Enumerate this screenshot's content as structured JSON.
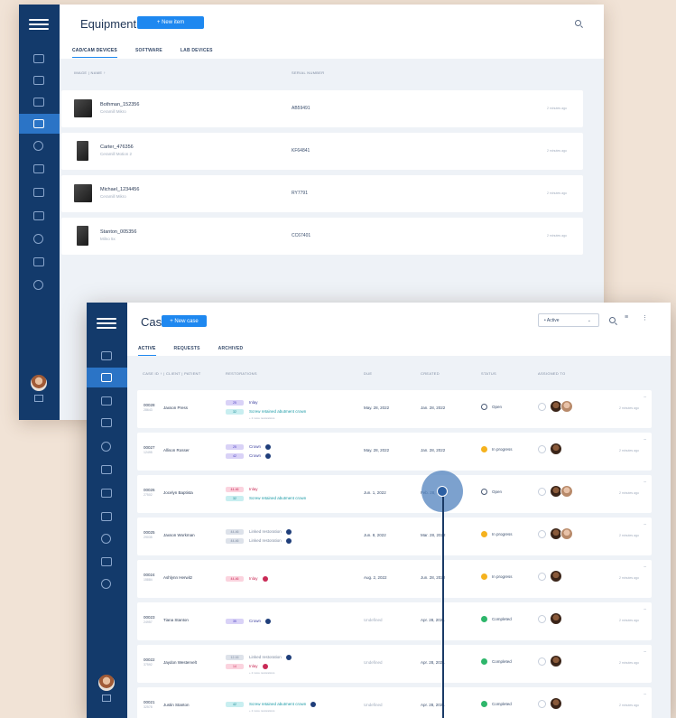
{
  "equipment": {
    "title": "Equipment",
    "new_button": "+ New item",
    "tabs": [
      "CAD/CAM DEVICES",
      "SOFTWARE",
      "LAB DEVICES"
    ],
    "columns": {
      "image_name": "IMAGE | NAME ↑",
      "serial": "SERIAL NUMBER"
    },
    "rows": [
      {
        "name": "Bothman_152356",
        "model": "Ceramill Mikro",
        "serial": "AB59491",
        "time": "2 minutes ago"
      },
      {
        "name": "Carter_476356",
        "model": "Ceramill Motion 2",
        "serial": "KF64841",
        "time": "2 minutes ago"
      },
      {
        "name": "Michael_1234456",
        "model": "Ceramill Mikro",
        "serial": "RY7791",
        "time": "2 minutes ago"
      },
      {
        "name": "Stanton_005356",
        "model": "Milno 5x",
        "serial": "CC67401",
        "time": "2 minutes ago"
      }
    ]
  },
  "cases": {
    "title": "Cases",
    "new_button": "+ New case",
    "filter_value": "• Active",
    "tabs": [
      "ACTIVE",
      "REQUESTS",
      "ARCHIVED"
    ],
    "columns": {
      "case_id": "CASE ID ↑ | CLIENT | PATIENT",
      "restorations": "RESTORATIONS",
      "due": "DUE",
      "created": "CREATED",
      "status": "STATUS",
      "assigned": "ASSIGNED TO"
    },
    "rows": [
      {
        "id": "00028",
        "sub": "28643",
        "client": "Jaxson Press",
        "restorations": [
          {
            "tag": "25",
            "text": "Inlay",
            "color": "purple",
            "mark": ""
          },
          {
            "tag": "32",
            "text": "Screw retained abutment crown",
            "color": "teal",
            "mark": ""
          }
        ],
        "note": "+ 2 more restorations",
        "due": "May. 28, 2022",
        "created": "Jan. 28, 2022",
        "status": "Open",
        "status_kind": "open",
        "avatars": 2,
        "time": "2 minutes ago"
      },
      {
        "id": "00027",
        "sub": "12495",
        "client": "Allison Rosser",
        "restorations": [
          {
            "tag": "25",
            "text": "Crown",
            "color": "purple",
            "mark": "ok"
          },
          {
            "tag": "42",
            "text": "Crown",
            "color": "purple",
            "mark": "ok"
          }
        ],
        "note": "",
        "due": "May. 28, 2022",
        "created": "Jan. 28, 2022",
        "status": "In progress",
        "status_kind": "prog",
        "avatars": 1,
        "time": "2 minutes ago"
      },
      {
        "id": "00026",
        "sub": "27502",
        "client": "Jocelyn Baptista",
        "restorations": [
          {
            "tag": "44-46",
            "text": "Inlay",
            "color": "pink",
            "mark": ""
          },
          {
            "tag": "32",
            "text": "Screw retained abutment crown",
            "color": "teal",
            "mark": ""
          }
        ],
        "note": "",
        "due": "Jun. 1, 2022",
        "created": "Feb. 28, 2022",
        "status": "Open",
        "status_kind": "open",
        "avatars": 2,
        "time": "2 minutes ago"
      },
      {
        "id": "00025",
        "sub": "29035",
        "client": "Jaxson Workman",
        "restorations": [
          {
            "tag": "44-46",
            "text": "Linked restoration",
            "color": "grey",
            "mark": "ok"
          },
          {
            "tag": "44-46",
            "text": "Linked restoration",
            "color": "grey",
            "mark": "ok"
          }
        ],
        "note": "",
        "due": "Jun. 8, 2022",
        "created": "Mar. 28, 2022",
        "status": "In progress",
        "status_kind": "prog",
        "avatars": 2,
        "time": "2 minutes ago"
      },
      {
        "id": "00024",
        "sub": "15884",
        "client": "Ashlynn Herwitz",
        "restorations": [
          {
            "tag": "44-46",
            "text": "Inlay",
            "color": "pink",
            "mark": "no"
          }
        ],
        "note": "",
        "due": "Aug. 2, 2022",
        "created": "Jun. 28, 2022",
        "status": "In progress",
        "status_kind": "prog",
        "avatars": 1,
        "time": "2 minutes ago"
      },
      {
        "id": "00023",
        "sub": "24957",
        "client": "Tiana Stanton",
        "restorations": [
          {
            "tag": "35",
            "text": "Crown",
            "color": "purple",
            "mark": "ok"
          }
        ],
        "note": "",
        "due": "Undefined",
        "created": "Apr. 28, 2021",
        "status": "Completed",
        "status_kind": "done",
        "avatars": 1,
        "time": "2 minutes ago"
      },
      {
        "id": "00022",
        "sub": "37592",
        "client": "Jaydon Westervelt",
        "restorations": [
          {
            "tag": "12-16",
            "text": "Linked restoration",
            "color": "grey",
            "mark": "ok"
          },
          {
            "tag": "14",
            "text": "Inlay",
            "color": "pink",
            "mark": "no"
          }
        ],
        "note": "+ 2 more restorations",
        "due": "Undefined",
        "created": "Apr. 28, 2021",
        "status": "Completed",
        "status_kind": "done",
        "avatars": 1,
        "time": "2 minutes ago"
      },
      {
        "id": "00021",
        "sub": "32578",
        "client": "Justin Stanton",
        "restorations": [
          {
            "tag": "42",
            "text": "Screw retained abutment crown",
            "color": "teal",
            "mark": "ok"
          }
        ],
        "note": "+ 2 more restorations",
        "due": "Undefined",
        "created": "Apr. 28, 2021",
        "status": "Completed",
        "status_kind": "done",
        "avatars": 1,
        "time": "2 minutes ago"
      }
    ]
  },
  "colors": {
    "sidebar": "#133a6b",
    "accent": "#1e88f0",
    "purple": "#d9d2f7",
    "teal": "#c8eef0",
    "pink": "#fbd3de",
    "grey": "#dde2ea"
  }
}
